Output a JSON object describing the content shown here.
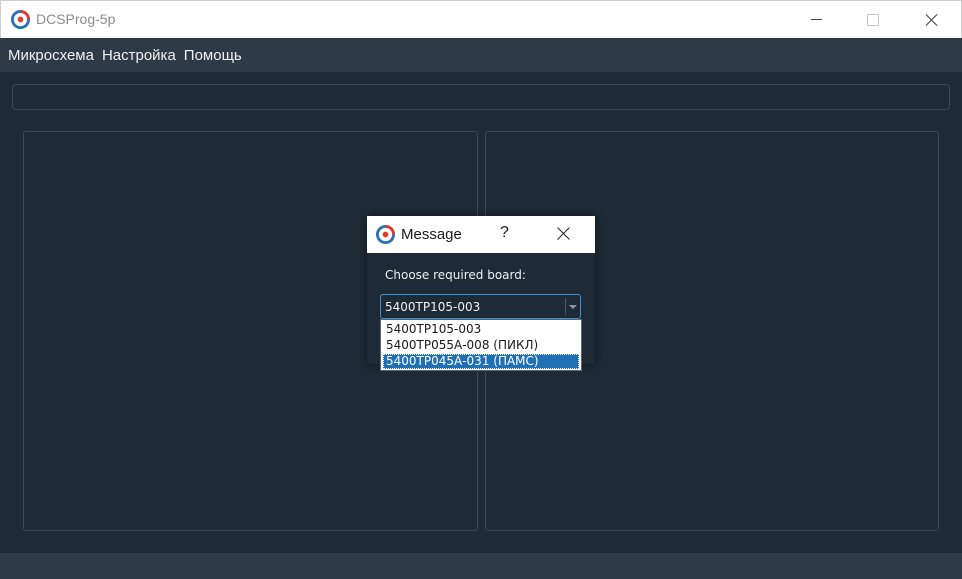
{
  "window": {
    "title": "DCSProg-5p",
    "icon": "dcsprog-logo-icon"
  },
  "menu": {
    "items": [
      {
        "label": "Микросхема"
      },
      {
        "label": "Настройка"
      },
      {
        "label": "Помощь"
      }
    ]
  },
  "dialog": {
    "title": "Message",
    "help_label": "?",
    "prompt": "Choose required board:",
    "combo": {
      "selected": "5400ТР105-003",
      "options": [
        "5400ТР105-003",
        "5400ТР055А-008 (ПИКЛ)",
        "5400ТР045А-031 (ПАМС)"
      ],
      "highlighted_index": 2
    }
  },
  "colors": {
    "window_bg": "#1e2a35",
    "menubar_bg": "#2e3b47",
    "focus_border": "#3d8fd6",
    "selection": "#1f6fb5",
    "logo_red": "#e03b2c",
    "logo_blue": "#2a6fb8"
  }
}
